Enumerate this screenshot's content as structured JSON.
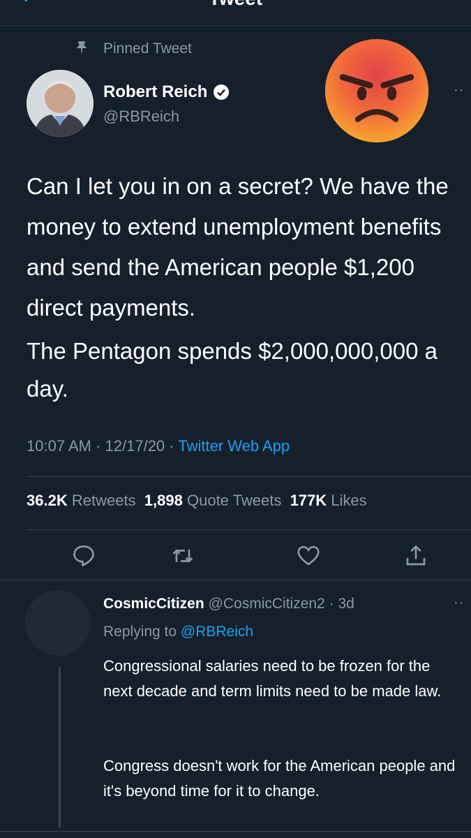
{
  "header": {
    "title": "Tweet"
  },
  "pinned": {
    "label": "Pinned Tweet",
    "icon": "pin-icon"
  },
  "author": {
    "name": "Robert Reich",
    "handle": "@RBReich",
    "verified_icon": "verified-badge-icon"
  },
  "overlay": {
    "icon": "angry-face-emoji"
  },
  "tweet": {
    "text_1": "Can I let you in on a secret? We have the money to extend unemployment benefits and send the American people $1,200 direct payments.",
    "text_2": "The Pentagon spends $2,000,000,000 a day.",
    "time": "10:07 AM",
    "date": "12/17/20",
    "source": "Twitter Web App",
    "separator": "·"
  },
  "stats": {
    "retweets_count": "36.2K",
    "retweets_label": "Retweets",
    "quotes_count": "1,898",
    "quotes_label": "Quote Tweets",
    "likes_count": "177K",
    "likes_label": "Likes"
  },
  "actions": [
    "reply-icon",
    "retweet-icon",
    "like-icon",
    "share-icon"
  ],
  "reply": {
    "name": "CosmicCitizen",
    "handle": "@CosmicCitizen2",
    "age": "3d",
    "replying_prefix": "Replying to",
    "replying_handle": "@RBReich",
    "text_1": "Congressional salaries need to be frozen for the next decade and term limits need to be made law.",
    "text_2": "Congress doesn't work for the American people and it's beyond time for it to change."
  },
  "colors": {
    "background": "#15202b",
    "muted": "#8899a6",
    "link": "#1da1f2",
    "divider": "#38444d"
  }
}
